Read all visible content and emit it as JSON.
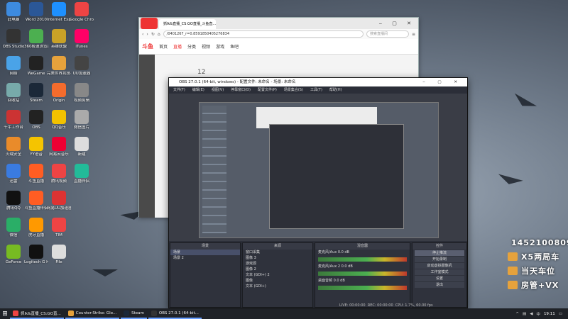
{
  "desktop_icons": [
    {
      "label": "此电脑",
      "color": "#3d8be0",
      "col": 0,
      "row": 0
    },
    {
      "label": "Word 2010",
      "color": "#2b5797",
      "col": 1,
      "row": 0
    },
    {
      "label": "Internet Explorer",
      "color": "#1e90ff",
      "col": 2,
      "row": 0
    },
    {
      "label": "Google Chrome",
      "color": "#e44",
      "col": 3,
      "row": 0
    },
    {
      "label": "OBS Studio",
      "color": "#333",
      "col": 0,
      "row": 1
    },
    {
      "label": "360极速浏览器",
      "color": "#4caf50",
      "col": 1,
      "row": 1
    },
    {
      "label": "英雄联盟",
      "color": "#c9a227",
      "col": 2,
      "row": 1
    },
    {
      "label": "iTunes",
      "color": "#f06",
      "col": 3,
      "row": 1
    },
    {
      "label": "网络",
      "color": "#4aa3e8",
      "col": 0,
      "row": 2
    },
    {
      "label": "WeGame",
      "color": "#222",
      "col": 1,
      "row": 2
    },
    {
      "label": "完美世界竞技平台",
      "color": "#e6a23c",
      "col": 2,
      "row": 2
    },
    {
      "label": "UU加速器",
      "color": "#444",
      "col": 3,
      "row": 2
    },
    {
      "label": "回收站",
      "color": "#7aa",
      "col": 0,
      "row": 3
    },
    {
      "label": "Steam",
      "color": "#1b2838",
      "col": 1,
      "row": 3
    },
    {
      "label": "Origin",
      "color": "#f56c2d",
      "col": 2,
      "row": 3
    },
    {
      "label": "视频剪辑",
      "color": "#888",
      "col": 3,
      "row": 3
    },
    {
      "label": "千牛工作台",
      "color": "#c33",
      "col": 0,
      "row": 4
    },
    {
      "label": "OBS",
      "color": "#222",
      "col": 1,
      "row": 4
    },
    {
      "label": "QQ音乐",
      "color": "#f2c200",
      "col": 2,
      "row": 4
    },
    {
      "label": "微信图片",
      "color": "#aaa",
      "col": 3,
      "row": 4
    },
    {
      "label": "火绒安全",
      "color": "#e98b2a",
      "col": 0,
      "row": 5
    },
    {
      "label": "YY语音",
      "color": "#f5c400",
      "col": 1,
      "row": 5
    },
    {
      "label": "网易云音乐",
      "color": "#e03",
      "col": 2,
      "row": 5
    },
    {
      "label": "新建",
      "color": "#ddd",
      "col": 3,
      "row": 5
    },
    {
      "label": "迅雷",
      "color": "#3a7be0",
      "col": 0,
      "row": 6
    },
    {
      "label": "斗鱼直播",
      "color": "#ff5d23",
      "col": 1,
      "row": 6
    },
    {
      "label": "腾讯视频",
      "color": "#e44",
      "col": 2,
      "row": 6
    },
    {
      "label": "直播伴侣",
      "color": "#2b9",
      "col": 3,
      "row": 6
    },
    {
      "label": "腾讯QQ",
      "color": "#111",
      "col": 0,
      "row": 7
    },
    {
      "label": "斗鱼直播伴侣",
      "color": "#ff5d23",
      "col": 1,
      "row": 7
    },
    {
      "label": "网易UU加速器",
      "color": "#d33",
      "col": 2,
      "row": 7
    },
    {
      "label": "微信",
      "color": "#2aae67",
      "col": 0,
      "row": 8
    },
    {
      "label": "虎牙直播",
      "color": "#f90",
      "col": 1,
      "row": 8
    },
    {
      "label": "TIM",
      "color": "#e44",
      "col": 2,
      "row": 8
    },
    {
      "label": "GeForce",
      "color": "#7b2",
      "col": 0,
      "row": 9
    },
    {
      "label": "Logitech G HUB",
      "color": "#111",
      "col": 1,
      "row": 9
    },
    {
      "label": "File",
      "color": "#ddd",
      "col": 2,
      "row": 9
    }
  ],
  "browser": {
    "tab_title": "抓lk&直播_CS:GO直播_斗鱼直...",
    "url": "/0401267_r=0.8591850405276834",
    "search_placeholder": "搜索直播间",
    "brand": "斗鱼",
    "nav": [
      "首页",
      "直播",
      "分类",
      "视频",
      "游戏",
      "鱼吧"
    ],
    "active_nav": "直播",
    "side_count": "12"
  },
  "obs": {
    "title": "OBS 27.0.1 (64-bit, windows) - 配置文件: 未命名 - 场景: 未命名",
    "menu": [
      "文件(F)",
      "编辑(E)",
      "视图(V)",
      "停靠窗口(D)",
      "配置文件(P)",
      "场景集合(S)",
      "工具(T)",
      "帮助(H)"
    ],
    "dock_headers": [
      "场景",
      "来源",
      "混音器",
      "转场特效",
      "控件"
    ],
    "scenes": [
      "场景",
      "场景 2"
    ],
    "sources": [
      "窗口采集",
      "图像 3",
      "游戏源",
      "图像 2",
      "文本 (GDI+) 2",
      "图像",
      "文本 (GDI+)"
    ],
    "mixer": [
      {
        "name": "麦克风/Aux",
        "db": "0.0 dB"
      },
      {
        "name": "麦克风/Aux 2",
        "db": "0.0 dB"
      },
      {
        "name": "桌面音频",
        "db": "0.0 dB"
      }
    ],
    "controls": [
      "停止推流",
      "开始录制",
      "启动虚拟摄像机",
      "工作室模式",
      "设置",
      "退出"
    ],
    "transition": "渐变",
    "status": {
      "live": "LIVE: 00:00:00",
      "rec": "REC: 00:00:00",
      "cpu": "CPU: 1.7%, 60.00 fps"
    }
  },
  "overlay": [
    {
      "text": "1452100809",
      "icon": "qq-icon"
    },
    {
      "text": "X5两局车",
      "icon": "car-icon"
    },
    {
      "text": "当天车位",
      "icon": "car-icon"
    },
    {
      "text": "房管+VX",
      "icon": "car-icon"
    }
  ],
  "taskbar": {
    "items": [
      {
        "label": "抓lk&直播_CS:GO直...",
        "color": "#e44"
      },
      {
        "label": "Counter-Strike: Glo...",
        "color": "#e6a23c"
      },
      {
        "label": "Steam",
        "color": "#1b2838"
      },
      {
        "label": "OBS 27.0.1 (64-bit...",
        "color": "#333"
      }
    ],
    "clock": "19:11",
    "ime": "中"
  }
}
